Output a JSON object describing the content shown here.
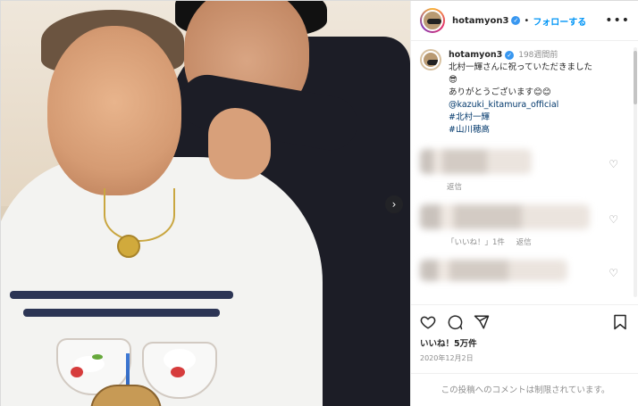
{
  "post": {
    "username": "hotamyon3",
    "verified_mark": "✓",
    "separator": "•",
    "follow_label": "フォローする",
    "more_label": "•••",
    "caption": {
      "username": "hotamyon3",
      "time_ago": "198週間前",
      "line1": "北村一輝さんに祝っていただきました",
      "line1_emoji": "😎",
      "line2": "ありがとうございます😊😊",
      "mention": "@kazuki_kitamura_official",
      "hashtag1": "#北村一輝",
      "hashtag2": "#山川穂高"
    },
    "comments": [
      {
        "reply_label": "返信",
        "likes_label": ""
      },
      {
        "reply_label": "返信",
        "likes_label": "「いいね！」1件"
      },
      {
        "reply_label": "",
        "likes_label": ""
      }
    ],
    "likes": "いいね！5万件",
    "date": "2020年12月2日",
    "comments_restricted": "この投稿へのコメントは制限されています。"
  },
  "colors": {
    "accent": "#0095f6",
    "link": "#00376b",
    "muted": "#8e8e8e"
  },
  "icons": [
    "heart-icon",
    "comment-icon",
    "share-icon",
    "bookmark-icon",
    "next-arrow-icon",
    "more-icon"
  ]
}
